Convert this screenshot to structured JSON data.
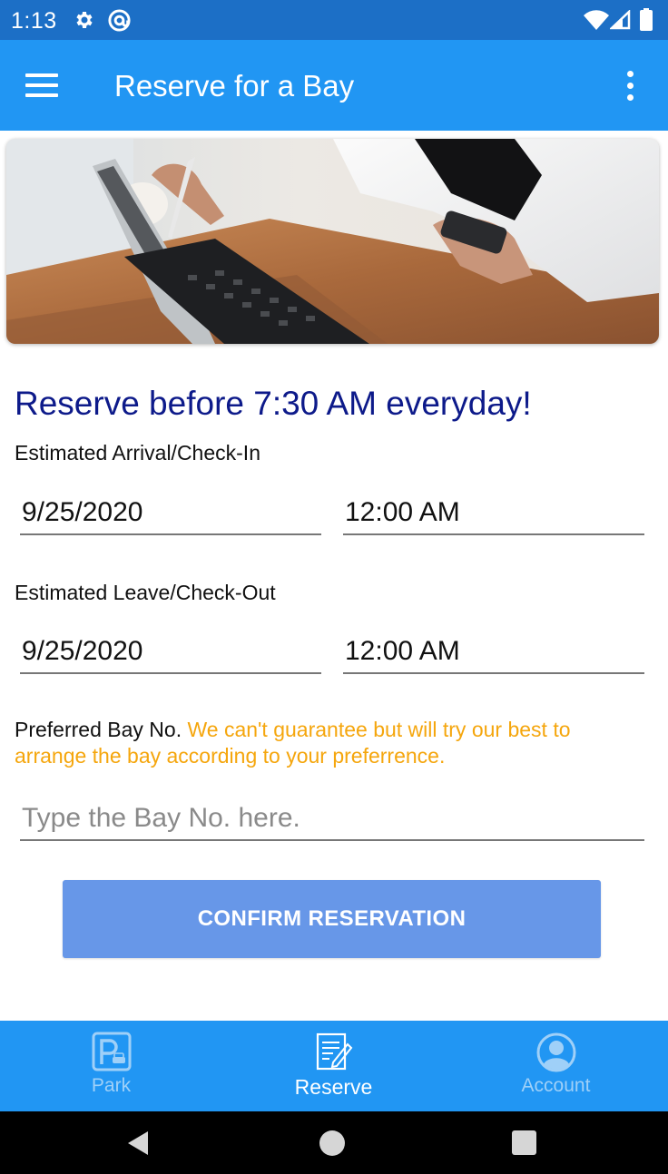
{
  "status_bar": {
    "time": "1:13",
    "icons": [
      "gear-icon",
      "sync-icon",
      "wifi-icon",
      "cell-signal-icon",
      "battery-icon"
    ]
  },
  "app_bar": {
    "title": "Reserve for a Bay",
    "left_icon": "menu-icon",
    "right_icon": "more-vert-icon"
  },
  "hero": {
    "image": "photo-woman-with-tablet-and-phone"
  },
  "form": {
    "headline": "Reserve before 7:30 AM everyday!",
    "arrival_label": "Estimated Arrival/Check-In",
    "arrival_date": "9/25/2020",
    "arrival_time": "12:00 AM",
    "leave_label": "Estimated Leave/Check-Out",
    "leave_date": "9/25/2020",
    "leave_time": "12:00 AM",
    "bay_label": "Preferred Bay No.",
    "bay_note": "We can't guarantee but will try our best to arrange the bay according to your preferrence.",
    "bay_value": "",
    "bay_placeholder": "Type the Bay No. here.",
    "confirm_label": "CONFIRM RESERVATION"
  },
  "bottom_nav": {
    "items": [
      {
        "label": "Park",
        "icon": "parking-icon",
        "active": false
      },
      {
        "label": "Reserve",
        "icon": "reserve-note-icon",
        "active": true
      },
      {
        "label": "Account",
        "icon": "account-icon",
        "active": false
      }
    ]
  },
  "system_nav": {
    "icons": [
      "back-icon",
      "home-icon",
      "recents-icon"
    ]
  },
  "colors": {
    "status_bar": "#1c6fc6",
    "primary": "#2196f3",
    "headline": "#0d1a8a",
    "warning_text": "#f5a60d",
    "button": "#6797e8",
    "nav_inactive": "#9fd0f8"
  }
}
